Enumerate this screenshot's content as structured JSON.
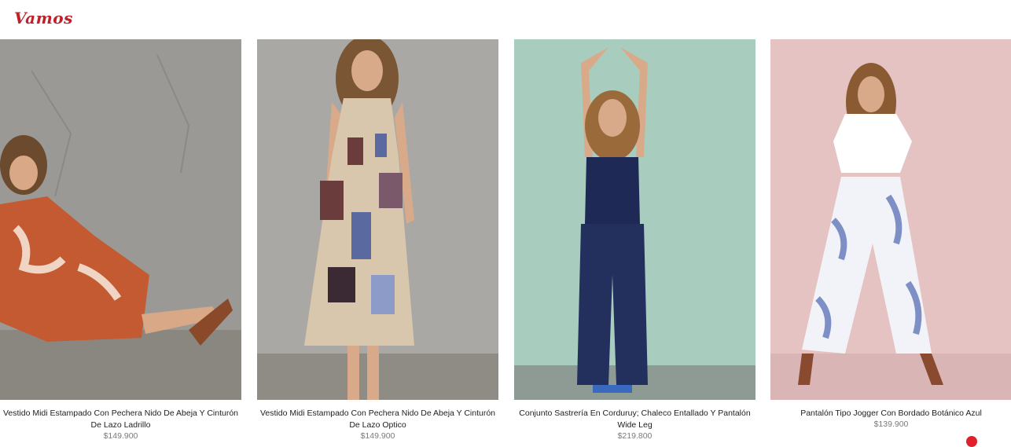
{
  "brand": {
    "logo_text": "Vamos",
    "accent": "#c0202a"
  },
  "products": [
    {
      "name": "Vestido Midi Estampado Con Pechera Nido De Abeja Y Cinturón De Lazo Ladrillo",
      "price": "$149.900",
      "bg": "#9c9a96",
      "dress": "#c45a32"
    },
    {
      "name": "Vestido Midi Estampado Con Pechera Nido De Abeja Y Cinturón De Lazo Optico",
      "price": "$149.900",
      "bg": "#a8a7a3",
      "dress": "#d9c7ad"
    },
    {
      "name": "Conjunto Sastrería En Corduruy; Chaleco Entallado Y Pantalón Wide Leg",
      "price": "$219.800",
      "bg": "#a9cdbf",
      "dress": "#1e2a55"
    },
    {
      "name": "Pantalón Tipo Jogger Con Bordado Botánico Azul",
      "price": "$139.900",
      "bg": "#e7c4c4",
      "dress": "#f2f3f8"
    }
  ]
}
